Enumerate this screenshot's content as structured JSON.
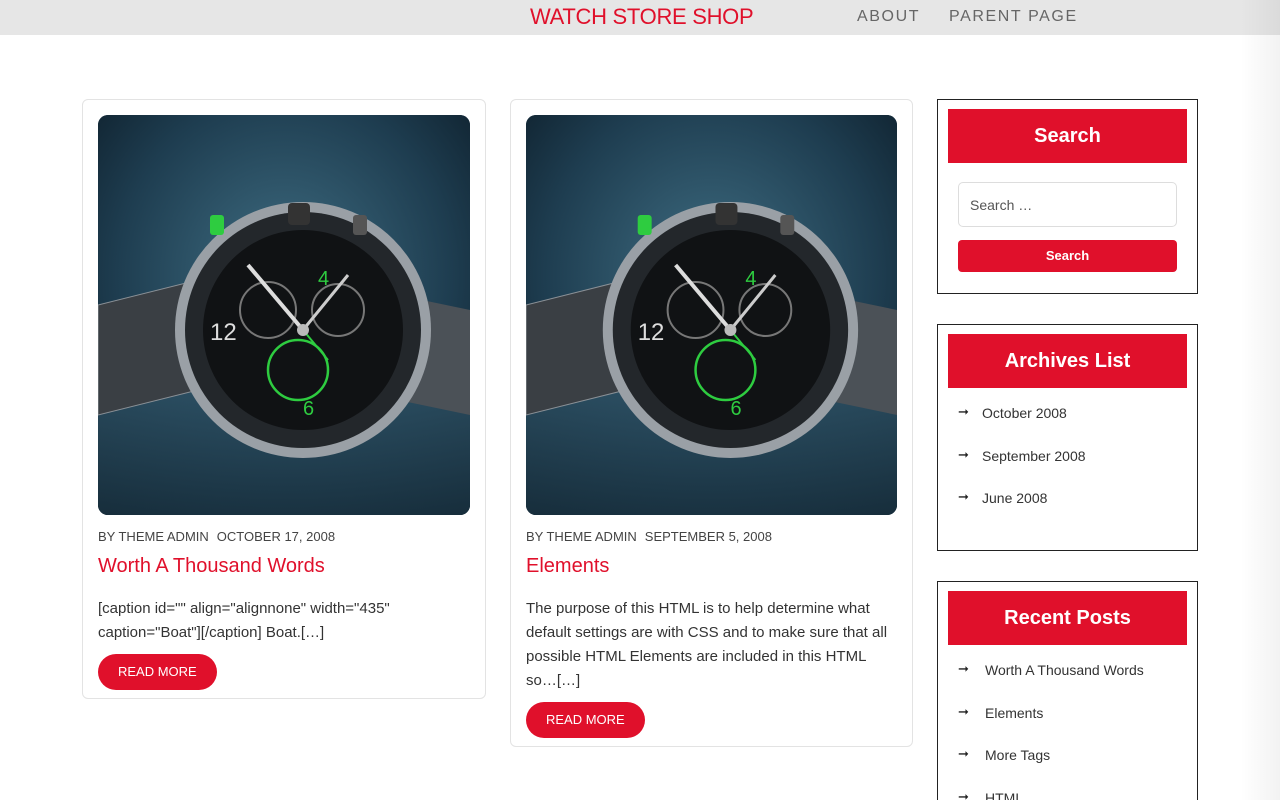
{
  "header": {
    "site_title": "WATCH STORE SHOP",
    "nav": [
      {
        "label": "ABOUT"
      },
      {
        "label": "PARENT PAGE"
      }
    ]
  },
  "posts": [
    {
      "author": "BY THEME ADMIN",
      "date": "OCTOBER 17, 2008",
      "title": "Worth A Thousand Words",
      "excerpt": "[caption id=\"\" align=\"alignnone\" width=\"435\" caption=\"Boat\"][/caption] Boat.[…]",
      "read_more": "READ MORE"
    },
    {
      "author": "BY THEME ADMIN",
      "date": "SEPTEMBER 5, 2008",
      "title": "Elements",
      "excerpt": "The purpose of this HTML is to help determine what default settings are with CSS and to make sure that all possible HTML Elements are included in this HTML so…[…]",
      "read_more": "READ MORE"
    }
  ],
  "sidebar": {
    "search": {
      "title": "Search",
      "placeholder": "Search …",
      "button": "Search"
    },
    "archives": {
      "title": "Archives List",
      "items": [
        {
          "label": "October 2008"
        },
        {
          "label": "September 2008"
        },
        {
          "label": "June 2008"
        }
      ]
    },
    "recent": {
      "title": "Recent Posts",
      "items": [
        {
          "label": "Worth A Thousand Words"
        },
        {
          "label": "Elements"
        },
        {
          "label": "More Tags"
        },
        {
          "label": "HTML"
        }
      ]
    }
  },
  "colors": {
    "accent": "#e0102b",
    "topbar": "#e6e6e6"
  },
  "icons": {
    "list_bullet": "arrow-right-icon"
  }
}
